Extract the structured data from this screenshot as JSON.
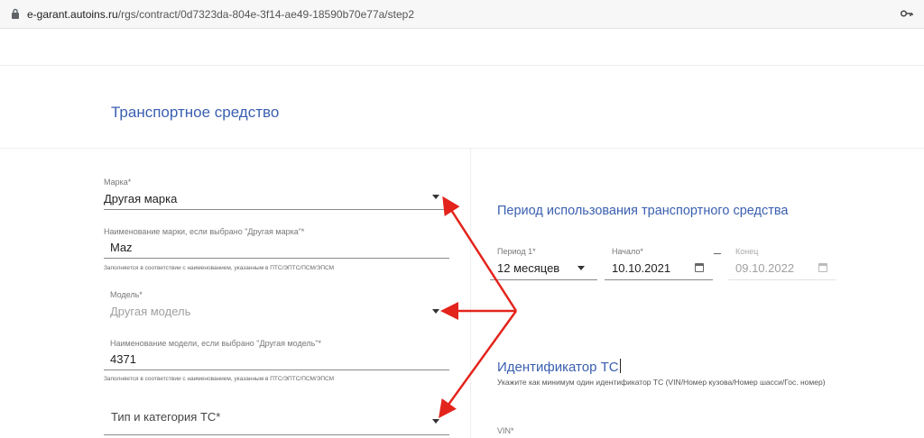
{
  "browser": {
    "host": "e-garant.autoins.ru",
    "path": "/rgs/contract/0d7323da-804e-3f14-ae49-18590b70e77a/step2"
  },
  "page": {
    "section_title": "Транспортное средство"
  },
  "left_form": {
    "brand": {
      "label": "Марка*",
      "value": "Другая марка"
    },
    "brand_name": {
      "label": "Наименование марки, если выбрано \"Другая марка\"*",
      "value": "Maz",
      "hint": "Заполняется в соответствии с наименованием, указанным в ПТС/ЭПТС/ПСМ/ЭПСМ"
    },
    "model": {
      "label": "Модель*",
      "value": "Другая модель"
    },
    "model_name": {
      "label": "Наименование модели, если выбрано \"Другая модель\"*",
      "value": "4371",
      "hint": "Заполняется в соответствии с наименованием, указанным в ПТС/ЭПТС/ПСМ/ЭПСМ"
    },
    "vehicle_type": {
      "placeholder": "Тип и категория ТС*"
    }
  },
  "usage_period": {
    "title": "Период использования транспортного средства",
    "period": {
      "label": "Период 1*",
      "value": "12 месяцев"
    },
    "start": {
      "label": "Начало*",
      "value": "10.10.2021"
    },
    "end": {
      "label": "Конец",
      "value": "09.10.2022"
    }
  },
  "identifier": {
    "title": "Идентификатор ТС",
    "description": "Укажите как минимум один идентификатор ТС (VIN/Номер кузова/Номер шасси/Гос. номер)",
    "vin_label": "VIN*"
  },
  "annotation": {
    "color": "#e3241c"
  }
}
